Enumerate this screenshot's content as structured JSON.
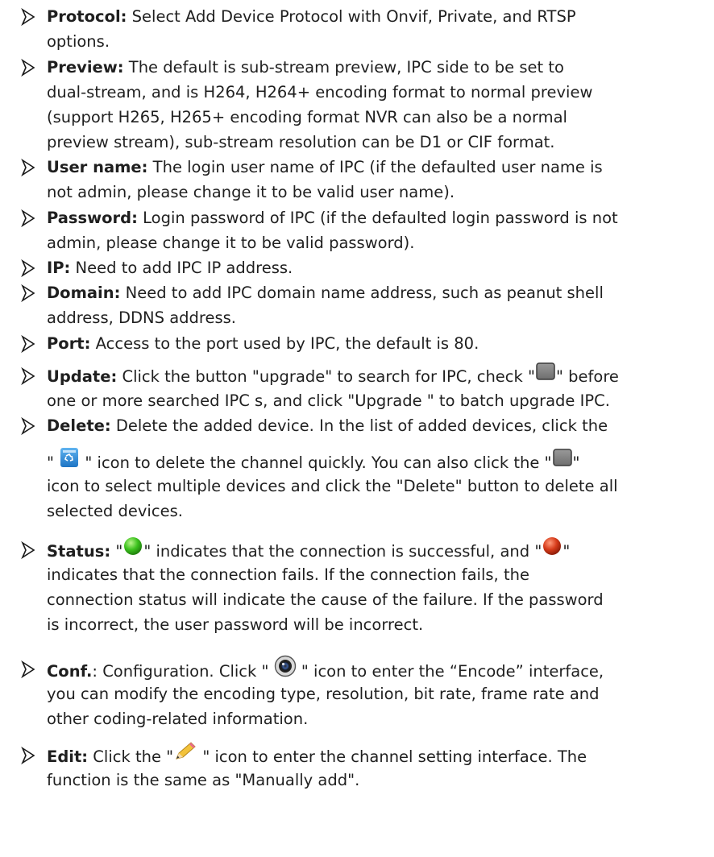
{
  "items": [
    {
      "key": "protocol",
      "term": "Protocol:",
      "l1": " Select Add Device Protocol with Onvif, Private, and RTSP",
      "l2": "options."
    },
    {
      "key": "preview",
      "term": "Preview:",
      "l1": " The default is sub-stream preview, IPC side to be set to",
      "l2": "dual-stream, and is H264, H264+ encoding format to normal preview",
      "l3": "(support H265, H265+ encoding format NVR can also be a normal",
      "l4": "preview stream), sub-stream resolution can be D1 or CIF format."
    },
    {
      "key": "username",
      "term": "User name:",
      "l1": " The login user name of IPC (if the defaulted user name is",
      "l2": "not admin, please change it to be valid user name)."
    },
    {
      "key": "password",
      "term": "Password:",
      "l1": " Login password of IPC (if the defaulted login password is not",
      "l2": "admin, please change it to be valid password)."
    },
    {
      "key": "ip",
      "term": "IP:",
      "l1": " Need to add IPC IP address."
    },
    {
      "key": "domain",
      "term": "Domain:",
      "l1": " Need to add IPC domain name address, such as peanut shell",
      "l2": "address, DDNS address."
    },
    {
      "key": "port",
      "term": "Port:",
      "l1": " Access to the port used by IPC, the default is 80."
    },
    {
      "key": "update",
      "term": "Update:",
      "l1a": " Click the button \"upgrade\" to search for IPC, check \"",
      "l1b": "\" before",
      "l2": "one or more searched IPC s, and click \"Upgrade \" to batch upgrade IPC."
    },
    {
      "key": "delete",
      "term": "Delete:",
      "l1": " Delete the added device. In the list of added devices, click the",
      "l2a": "\" ",
      "l2b": " \" icon to delete the channel quickly. You can also click the \"",
      "l2c": "\"",
      "l3": "icon to select multiple devices and click the \"Delete\" button to delete all",
      "l4": "selected devices."
    },
    {
      "key": "status",
      "term": "Status:",
      "l1a": " \"",
      "l1b": "\" indicates that the connection is successful, and \"",
      "l1c": "\"",
      "l2": "indicates that the connection fails. If the connection fails, the",
      "l3": "connection status will indicate the cause of the failure. If the password",
      "l4": "is incorrect, the user password will be incorrect."
    },
    {
      "key": "conf",
      "term": "Conf.",
      "l1a": ": Configuration. Click \" ",
      "l1b": " \" icon to enter the “Encode” interface,",
      "l2": "you can modify the encoding type, resolution, bit rate, frame rate and",
      "l3": "other coding-related information."
    },
    {
      "key": "edit",
      "term": "Edit:",
      "l1a": " Click the \"",
      "l1b": " \" icon to enter the channel setting interface. The",
      "l2": "function is the same as \"Manually add\"."
    }
  ],
  "icons": {
    "bullet": "arrow-bullet-icon",
    "checkbox": "checkbox-icon",
    "recycle": "recycle-bin-icon",
    "online": "green-status-dot-icon",
    "offline": "red-status-dot-icon",
    "camera": "camera-lens-icon",
    "pencil": "pencil-icon"
  },
  "colors": {
    "text": "#1f1f1f",
    "online": "#3cc21e",
    "offline": "#d63b1a",
    "recycle": "#2f8fd8"
  }
}
